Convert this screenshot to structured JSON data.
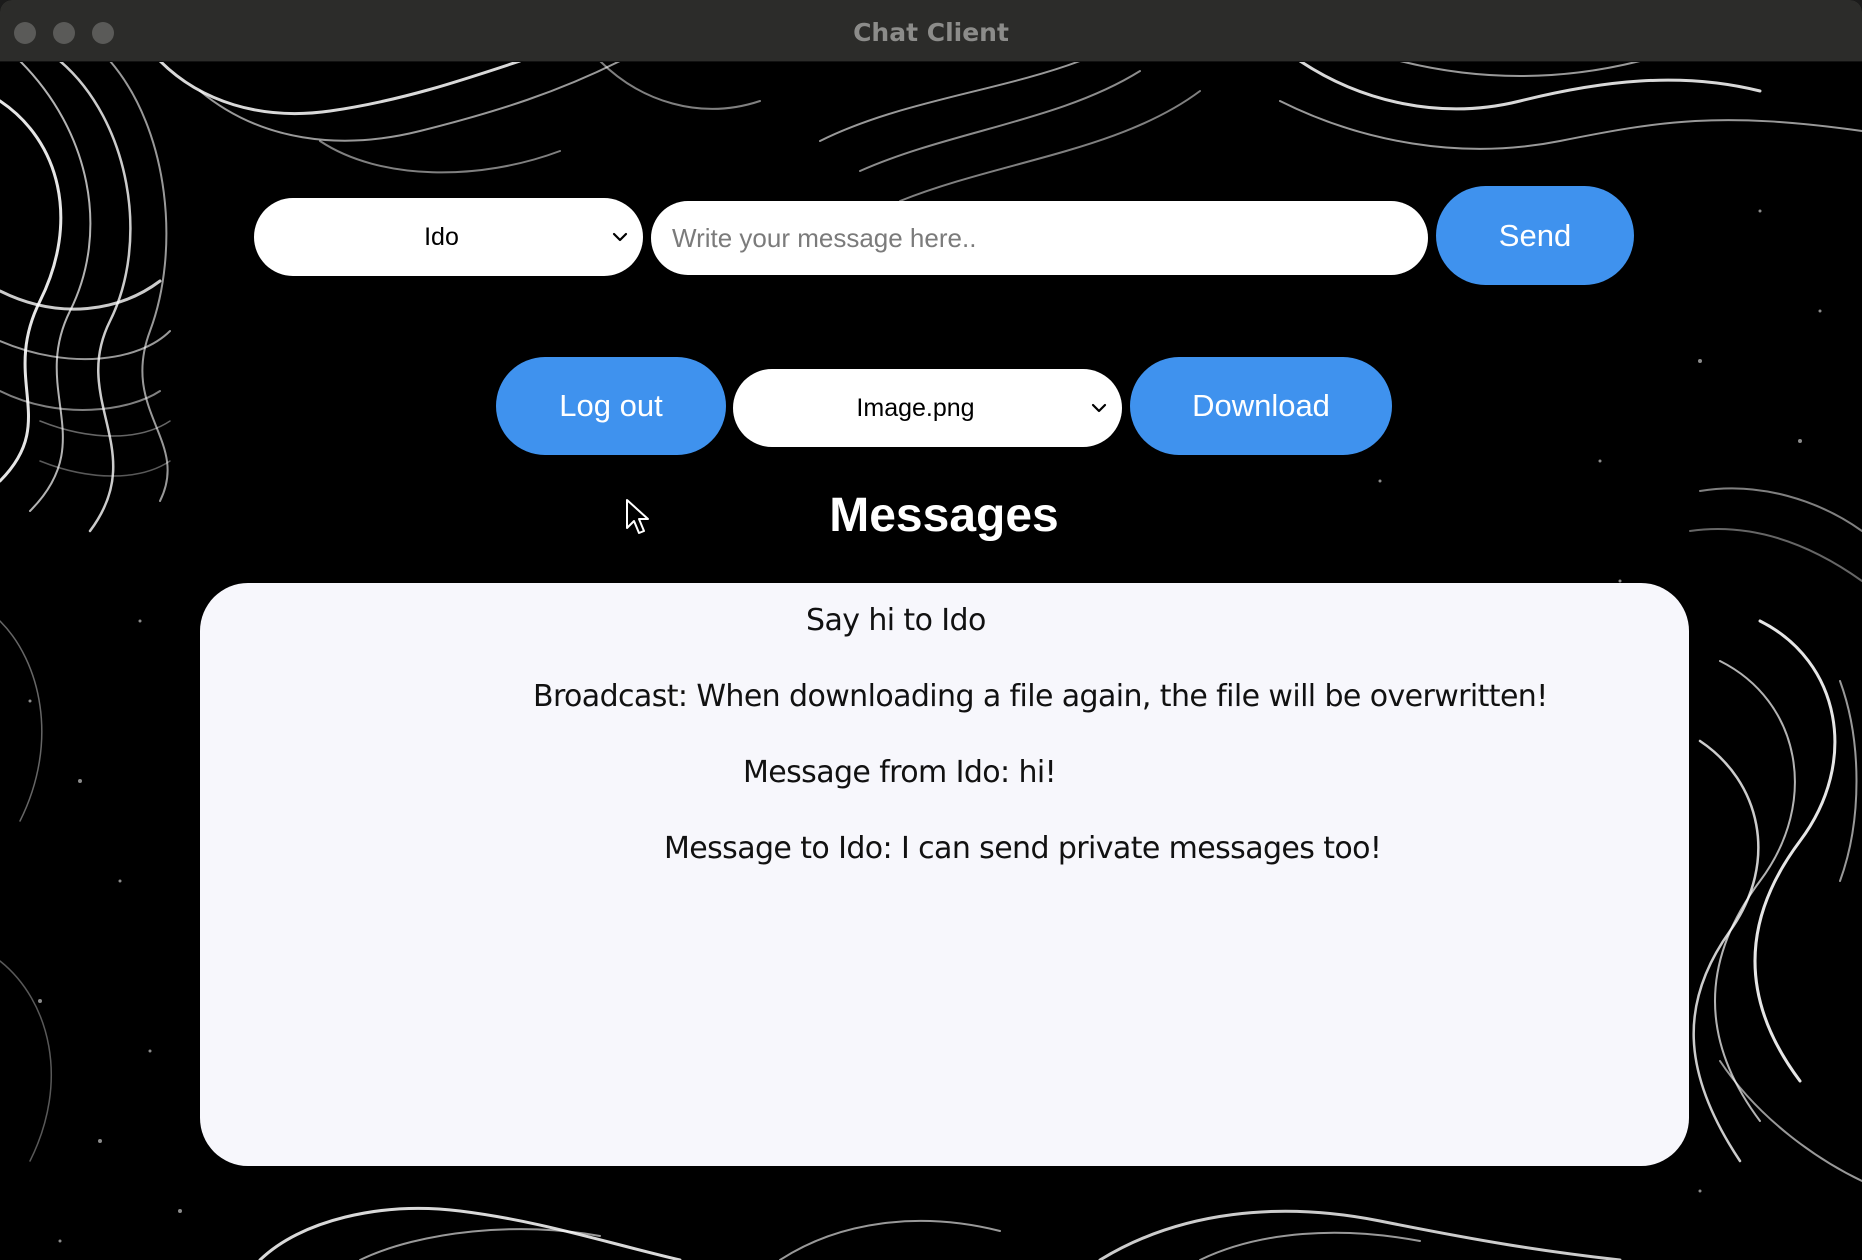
{
  "window": {
    "title": "Chat Client"
  },
  "compose": {
    "recipient_selected": "Ido",
    "message_placeholder": "Write your message here..",
    "message_value": "",
    "send_label": "Send"
  },
  "files": {
    "logout_label": "Log out",
    "file_selected": "Image.png",
    "download_label": "Download"
  },
  "messages": {
    "heading": "Messages",
    "items": [
      "Say hi to Ido",
      "Broadcast: When downloading a file again, the file will be overwritten!",
      "Message from Ido: hi!",
      "Message to Ido: I can send private messages too!"
    ]
  },
  "colors": {
    "accent": "#3f92ee",
    "background": "#000000",
    "panel": "#f7f7fc"
  }
}
